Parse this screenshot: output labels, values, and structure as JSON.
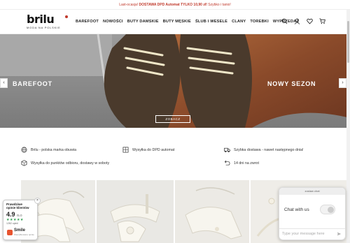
{
  "promo": {
    "lead": "Last-ocasja!",
    "bold": "DOSTAWA DPD Automat TYLKO 10,90 zł!",
    "tail": "Szybko i tanio!"
  },
  "logo": {
    "name": "brilu",
    "tagline": "MODA NA POLSKIE"
  },
  "nav": [
    "BAREFOOT",
    "NOWOŚCI",
    "BUTY DAMSKIE",
    "BUTY MĘSKIE",
    "ŚLUB I WESELE",
    "CLANY",
    "TOREBKI",
    "WYPRZEDAŻ"
  ],
  "header_icons": [
    "search-icon",
    "user-icon",
    "heart-icon",
    "cart-icon"
  ],
  "hero": {
    "left_title": "BAREFOOT",
    "right_title": "NOWY SEZON",
    "button": "ZOBACZ",
    "prev": "‹",
    "next": "›"
  },
  "features": [
    {
      "icon": "globe-icon",
      "text": "Brilu - polska marka obuwia"
    },
    {
      "icon": "parcel-locker-icon",
      "text": "Wysyłka do DPD automat"
    },
    {
      "icon": "truck-icon",
      "text": "Szybka dostawa - nawet następnego dnia!"
    },
    {
      "icon": "box-icon",
      "text": "Wysyłka do punktów odbioru, dostawy w soboty"
    },
    {
      "icon": "return-icon",
      "text": "14 dni na zwrot"
    }
  ],
  "badge": {
    "line1": "Prawdziwe",
    "line2": "opinie klientów",
    "score": "4.9",
    "scale": "/5.0",
    "stars": "★★★★★",
    "count": "1282 opinii",
    "brand": "Smile",
    "brand_sub": "Zweryfikowane opinie",
    "close": "×"
  },
  "chat": {
    "header": "zostaw chat",
    "title": "Chat with us",
    "placeholder": "Type your message here"
  },
  "colors": {
    "accent": "#c0392b",
    "stars": "#2f9e4f",
    "smile": "#e8542f",
    "leather": "#8a4a2a"
  }
}
